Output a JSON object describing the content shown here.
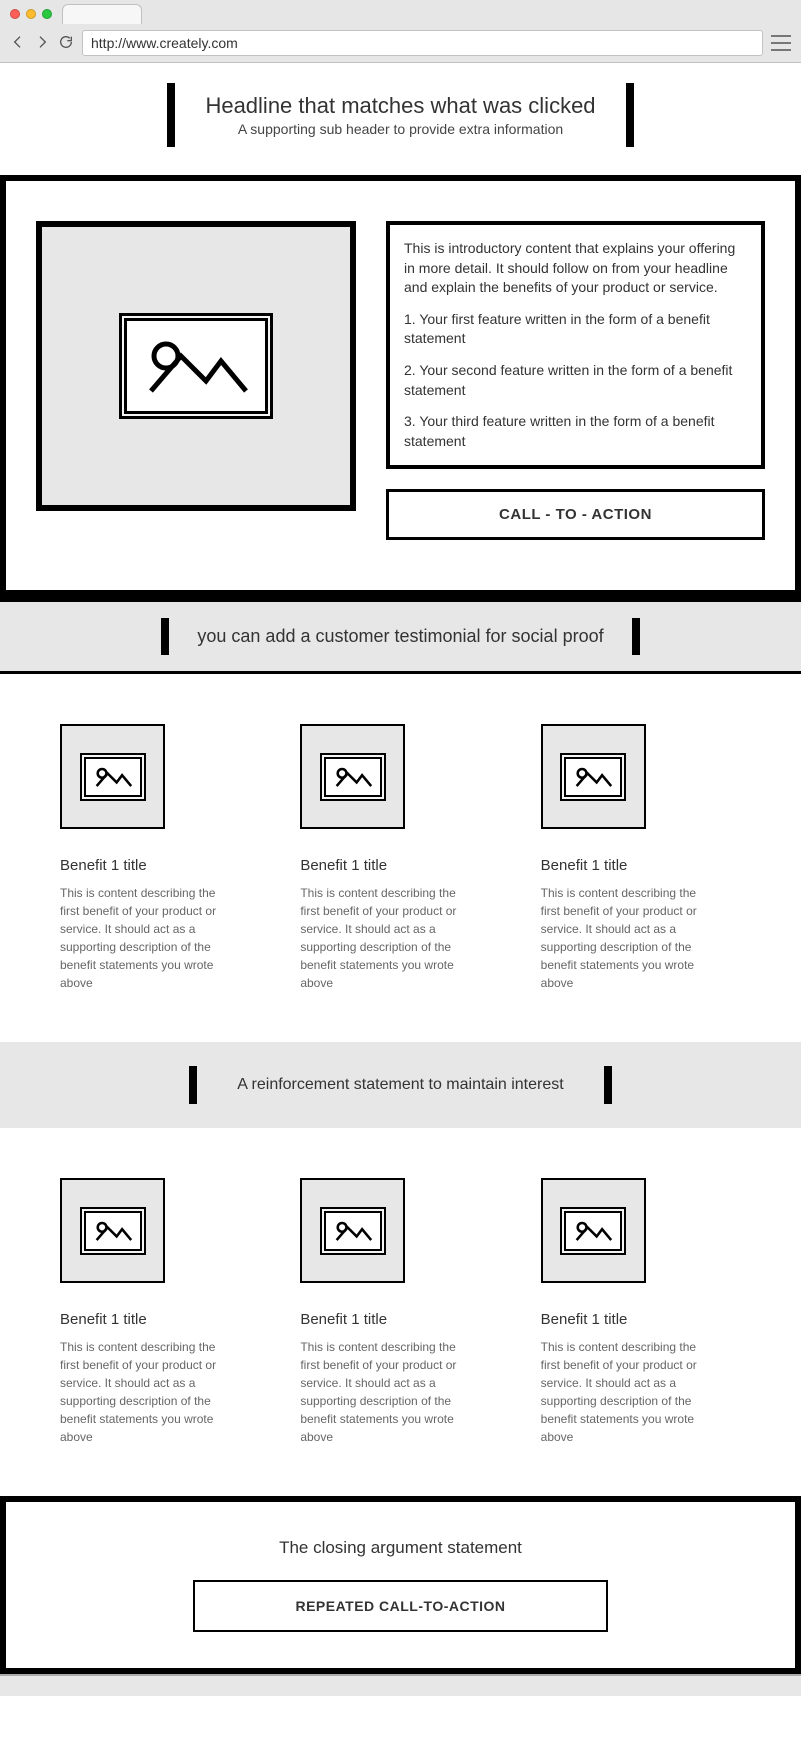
{
  "browser": {
    "url": "http://www.creately.com"
  },
  "header": {
    "headline": "Headline that matches what was clicked",
    "subheader": "A supporting sub header to provide extra information"
  },
  "intro": {
    "lead": "This is introductory content that explains your offering in more detail. It should follow on from your headline and explain the benefits of your product or service.",
    "feature1": "1. Your first feature written in the form of a benefit statement",
    "feature2": "2. Your second feature written in the form of a benefit statement",
    "feature3": "3. Your third feature written in the form of a benefit statement"
  },
  "cta_primary": "CALL - TO - ACTION",
  "testimonial": "you can add a customer testimonial for social proof",
  "benefits_top": [
    {
      "title": "Benefit 1 title",
      "desc": "This is content describing the first benefit of your product or service. It should act as a supporting description of the benefit statements you wrote above"
    },
    {
      "title": "Benefit 1 title",
      "desc": "This is content describing the first benefit of your product or service. It should act as a supporting description of the benefit statements you wrote above"
    },
    {
      "title": "Benefit 1 title",
      "desc": "This is content describing the first benefit of your product or service. It should act as a supporting description of the benefit statements you wrote above"
    }
  ],
  "reinforcement": "A reinforcement statement to maintain interest",
  "benefits_bottom": [
    {
      "title": "Benefit 1 title",
      "desc": "This is content describing the first benefit of your product or service. It should act as a supporting description of the benefit statements you wrote above"
    },
    {
      "title": "Benefit 1 title",
      "desc": "This is content describing the first benefit of your product or service. It should act as a supporting description of the benefit statements you wrote above"
    },
    {
      "title": "Benefit 1 title",
      "desc": "This is content describing the first benefit of your product or service. It should act as a supporting description of the benefit statements you wrote above"
    }
  ],
  "closing": {
    "statement": "The closing argument statement",
    "cta": "REPEATED CALL-TO-ACTION"
  }
}
